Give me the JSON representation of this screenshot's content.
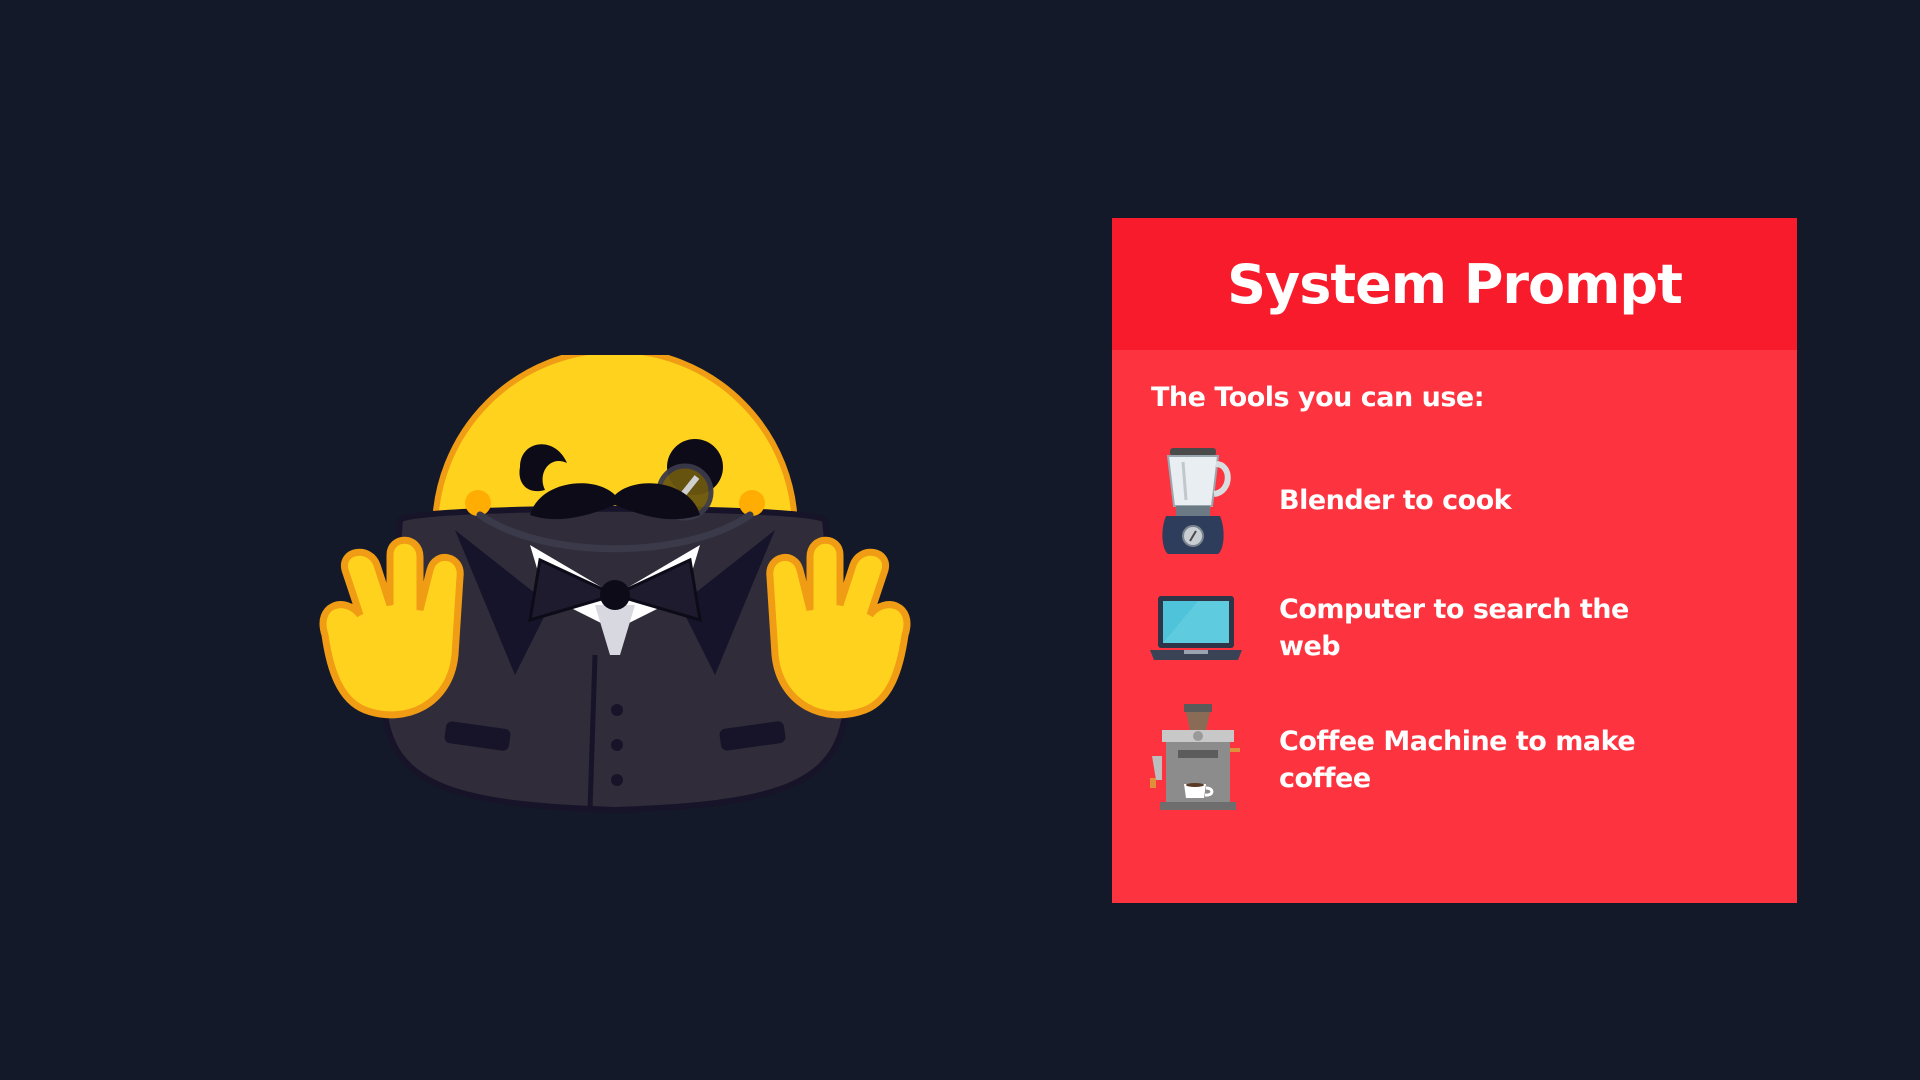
{
  "mascot": {
    "icon": "hugging-face-butler-mascot-icon"
  },
  "panel": {
    "title": "System Prompt",
    "subtitle": "The Tools you can use:",
    "colors": {
      "header": "#f71b2b",
      "body": "#fe3340",
      "background": "#131928"
    },
    "tools": [
      {
        "icon": "blender-icon",
        "label": "Blender to cook"
      },
      {
        "icon": "laptop-icon",
        "label": "Computer to search the web"
      },
      {
        "icon": "coffee-machine-icon",
        "label": "Coffee Machine to make coffee"
      }
    ]
  }
}
